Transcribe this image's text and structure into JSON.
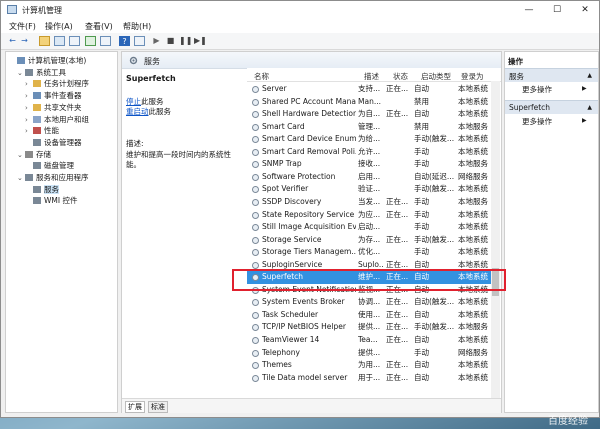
{
  "window": {
    "title": "计算机管理",
    "buttons": [
      "—",
      "☐",
      "✕"
    ]
  },
  "menu": [
    "文件(F)",
    "操作(A)",
    "查看(V)",
    "帮助(H)"
  ],
  "tree": {
    "items": [
      {
        "label": "计算机管理(本地)",
        "level": 0,
        "exp": ""
      },
      {
        "label": "系统工具",
        "level": 1,
        "exp": "⌄"
      },
      {
        "label": "任务计划程序",
        "level": 2,
        "exp": "›"
      },
      {
        "label": "事件查看器",
        "level": 2,
        "exp": "›"
      },
      {
        "label": "共享文件夹",
        "level": 2,
        "exp": "›"
      },
      {
        "label": "本地用户和组",
        "level": 2,
        "exp": "›"
      },
      {
        "label": "性能",
        "level": 2,
        "exp": "›"
      },
      {
        "label": "设备管理器",
        "level": 2,
        "exp": ""
      },
      {
        "label": "存储",
        "level": 1,
        "exp": "⌄"
      },
      {
        "label": "磁盘管理",
        "level": 2,
        "exp": ""
      },
      {
        "label": "服务和应用程序",
        "level": 1,
        "exp": "⌄"
      },
      {
        "label": "服务",
        "level": 2,
        "exp": "",
        "selected": true
      },
      {
        "label": "WMI 控件",
        "level": 2,
        "exp": ""
      }
    ]
  },
  "services_header": "服务",
  "detail": {
    "name": "Superfetch",
    "stop_link": "停止",
    "stop_suffix": "此服务",
    "restart_link": "重启动",
    "restart_suffix": "此服务",
    "desc_label": "描述:",
    "desc_text": "维护和提高一段时间内的系统性能。"
  },
  "columns": [
    "名称",
    "描述",
    "状态",
    "启动类型",
    "登录为"
  ],
  "rows": [
    [
      "Server",
      "支持...",
      "正在...",
      "自动",
      "本地系统"
    ],
    [
      "Shared PC Account Mana...",
      "Man...",
      "",
      "禁用",
      "本地系统"
    ],
    [
      "Shell Hardware Detection",
      "为自...",
      "正在...",
      "自动",
      "本地系统"
    ],
    [
      "Smart Card",
      "管理...",
      "",
      "禁用",
      "本地服务"
    ],
    [
      "Smart Card Device Enum...",
      "为给...",
      "",
      "手动(触发...",
      "本地系统"
    ],
    [
      "Smart Card Removal Poli...",
      "允许...",
      "",
      "手动",
      "本地系统"
    ],
    [
      "SNMP Trap",
      "接收...",
      "",
      "手动",
      "本地服务"
    ],
    [
      "Software Protection",
      "启用...",
      "",
      "自动(延迟...",
      "网络服务"
    ],
    [
      "Spot Verifier",
      "验证...",
      "",
      "手动(触发...",
      "本地系统"
    ],
    [
      "SSDP Discovery",
      "当发...",
      "正在...",
      "手动",
      "本地服务"
    ],
    [
      "State Repository Service",
      "为应...",
      "正在...",
      "手动",
      "本地系统"
    ],
    [
      "Still Image Acquisition Ev...",
      "启动...",
      "",
      "手动",
      "本地系统"
    ],
    [
      "Storage Service",
      "为存...",
      "正在...",
      "手动(触发...",
      "本地系统"
    ],
    [
      "Storage Tiers Managem...",
      "优化...",
      "",
      "手动",
      "本地系统"
    ],
    [
      "SuploginService",
      "Suplo...",
      "正在...",
      "自动",
      "本地系统"
    ],
    [
      "Superfetch",
      "维护...",
      "正在...",
      "自动",
      "本地系统"
    ],
    [
      "System Event Notification...",
      "监视...",
      "正在...",
      "自动",
      "本地系统"
    ],
    [
      "System Events Broker",
      "协调...",
      "正在...",
      "自动(触发...",
      "本地系统"
    ],
    [
      "Task Scheduler",
      "使用...",
      "正在...",
      "自动",
      "本地系统"
    ],
    [
      "TCP/IP NetBIOS Helper",
      "提供...",
      "正在...",
      "手动(触发...",
      "本地服务"
    ],
    [
      "TeamViewer 14",
      "Tea...",
      "正在...",
      "自动",
      "本地系统"
    ],
    [
      "Telephony",
      "提供...",
      "",
      "手动",
      "网络服务"
    ],
    [
      "Themes",
      "为用...",
      "正在...",
      "自动",
      "本地系统"
    ],
    [
      "Tile Data model server",
      "用于...",
      "正在...",
      "自动",
      "本地系统"
    ]
  ],
  "selected_index": 15,
  "tabs": [
    "扩展",
    "标准"
  ],
  "actions": {
    "title": "操作",
    "sections": [
      {
        "label": "服务",
        "item": "更多操作"
      },
      {
        "label": "Superfetch",
        "item": "更多操作"
      }
    ]
  },
  "watermark": "百度经验"
}
